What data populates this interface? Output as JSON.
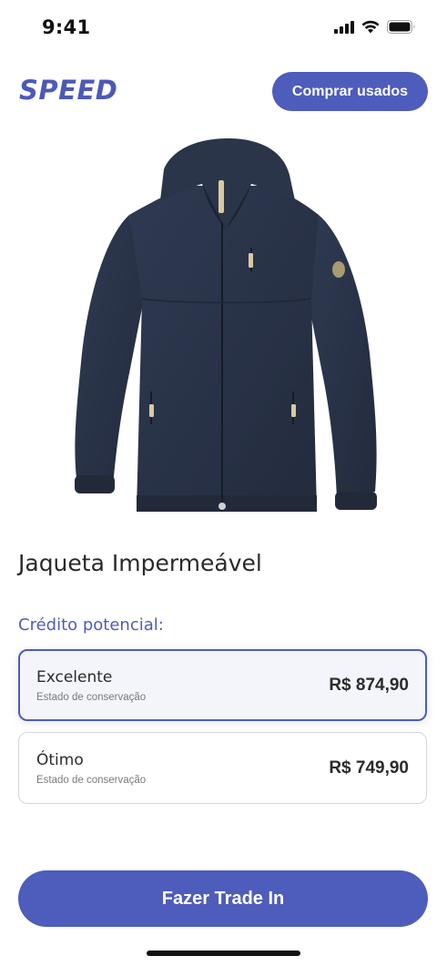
{
  "status_bar": {
    "time": "9:41",
    "icons": [
      "cellular-signal-icon",
      "wifi-icon",
      "battery-icon"
    ]
  },
  "header": {
    "logo": "SPEED",
    "buy_used_label": "Comprar usados"
  },
  "product": {
    "image": "navy-rain-jacket",
    "title": "Jaqueta Impermeável"
  },
  "credit": {
    "label": "Crédito potencial:",
    "options": [
      {
        "name": "Excelente",
        "subtitle": "Estado de conservação",
        "price": "R$ 874,90",
        "selected": true
      },
      {
        "name": "Ótimo",
        "subtitle": "Estado de conservação",
        "price": "R$ 749,90",
        "selected": false
      }
    ]
  },
  "action": {
    "trade_in_label": "Fazer Trade In"
  },
  "colors": {
    "accent": "#4e5cbb",
    "selected_bg": "#f3f5fb",
    "jacket": "#283246"
  }
}
